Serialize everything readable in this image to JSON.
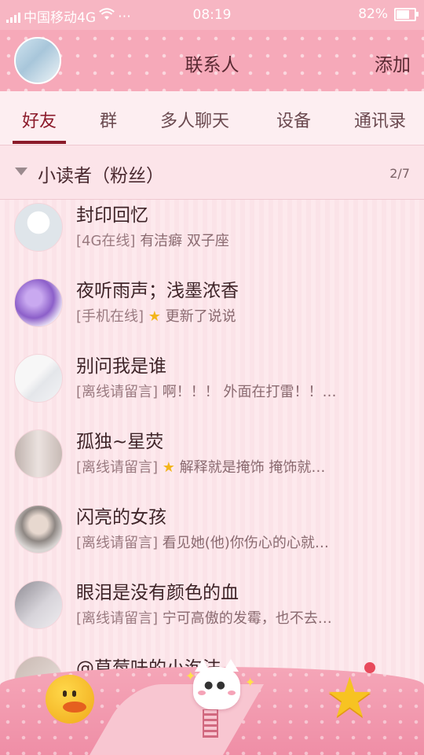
{
  "status_bar": {
    "carrier": "中国移动4G",
    "more": "⋯",
    "time": "08:19",
    "battery_text": "82%",
    "battery_level": 0.82
  },
  "header": {
    "title": "联系人",
    "add_label": "添加"
  },
  "tabs": [
    {
      "label": "好友",
      "active": true
    },
    {
      "label": "群"
    },
    {
      "label": "多人聊天"
    },
    {
      "label": "设备"
    },
    {
      "label": "通讯录"
    }
  ],
  "group": {
    "name": "小读者（粉丝）",
    "count": "2/7"
  },
  "contacts": [
    {
      "name": "封印回忆",
      "tag": "[4G在线]",
      "star": false,
      "text": "有洁癖  双子座",
      "avatar_color": "#dfe5ea"
    },
    {
      "name": "夜听雨声；浅墨浓香",
      "tag": "[手机在线]",
      "star": true,
      "text": "更新了说说",
      "avatar_color": "#8c5fc9"
    },
    {
      "name": "别问我是谁",
      "tag": "[离线请留言]",
      "star": false,
      "text": "啊！！！ 外面在打雷！！…",
      "avatar_color": "#e9eef0"
    },
    {
      "name": "孤独~星荧",
      "tag": "[离线请留言]",
      "star": true,
      "text": "解释就是掩饰 掩饰就…",
      "avatar_color": "#d7cfd0"
    },
    {
      "name": "闪亮的女孩",
      "tag": "[离线请留言]",
      "star": false,
      "text": "看见她(他)你伤心的心就…",
      "avatar_color": "#b8b1ad"
    },
    {
      "name": "眼泪是没有颜色的血",
      "tag": "[离线请留言]",
      "star": false,
      "text": "宁可高傲的发霉，也不去…",
      "avatar_color": "#c9c6cb"
    },
    {
      "name": "@草莓味的小泡沫",
      "tag": "",
      "star": false,
      "text": "",
      "avatar_color": "#d9cfcc"
    }
  ],
  "icons": {
    "star": "★",
    "footer_left": "duck-icon",
    "footer_center": "cat-spring-icon",
    "footer_right": "star-icon"
  },
  "colors": {
    "header_bg": "#f6a9b9",
    "accent": "#8b1a2a",
    "footer_bg": "#ef8ea6"
  }
}
